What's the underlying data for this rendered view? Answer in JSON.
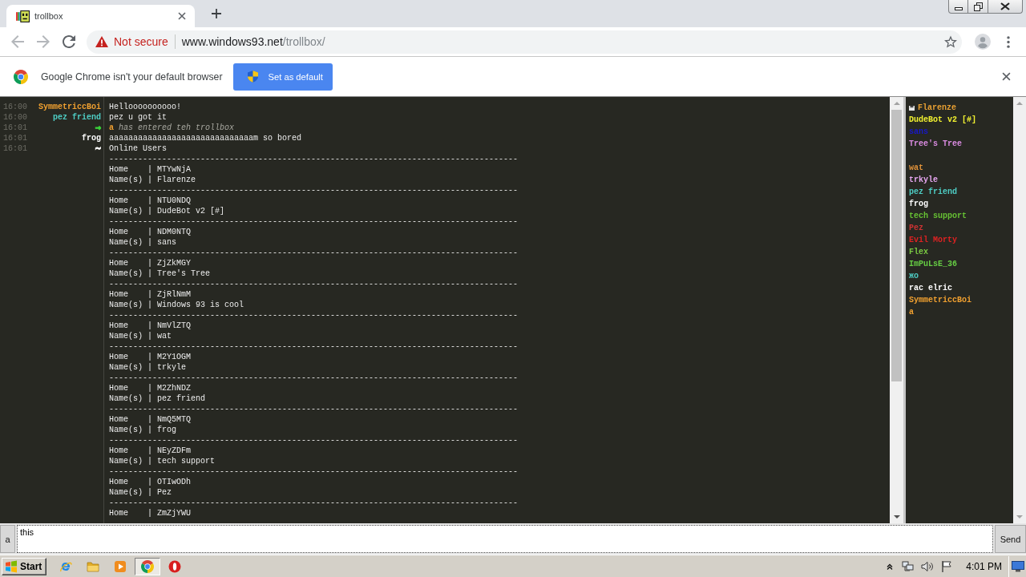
{
  "browser": {
    "tabs": [
      {
        "title": "trollbox",
        "selected": true
      }
    ],
    "address": {
      "security": "Not secure",
      "host": "www.windows93.net",
      "path": "/trollbox/"
    },
    "infobar": {
      "message": "Google Chrome isn't your default browser",
      "button": "Set as default"
    }
  },
  "chat": {
    "messages": [
      {
        "kind": "chat",
        "time": "16:00",
        "nick": "SymmetriccBoi",
        "color": "#f0a030",
        "text": "Helloooooooooo!"
      },
      {
        "kind": "chat",
        "time": "16:00",
        "nick": "pez friend",
        "color": "#4ecdc4",
        "text": "pez u got it"
      },
      {
        "kind": "join",
        "time": "16:01",
        "nick": "→",
        "color": "#3ad23a",
        "user": {
          "name": "a",
          "color": "#f0a030"
        },
        "text": "has entered teh trollbox"
      },
      {
        "kind": "chat",
        "time": "16:01",
        "nick": "frog",
        "color": "#ffffff",
        "text": "aaaaaaaaaaaaaaaaaaaaaaaaaaaaaam so bored"
      },
      {
        "kind": "list",
        "time": "16:01",
        "nick": "~",
        "color": "#ffffff",
        "text": "Online Users",
        "lines": [
          "-------------------------------------------------------------------------------------",
          "Home    | MTYwNjA",
          "Name(s) | Flarenze",
          "-------------------------------------------------------------------------------------",
          "Home    | NTU0NDQ",
          "Name(s) | DudeBot v2 [#]",
          "-------------------------------------------------------------------------------------",
          "Home    | NDM0NTQ",
          "Name(s) | sans",
          "-------------------------------------------------------------------------------------",
          "Home    | ZjZkMGY",
          "Name(s) | Tree's Tree",
          "-------------------------------------------------------------------------------------",
          "Home    | ZjRlNmM",
          "Name(s) | Windows 93 is cool",
          "-------------------------------------------------------------------------------------",
          "Home    | NmVlZTQ",
          "Name(s) | wat",
          "-------------------------------------------------------------------------------------",
          "Home    | M2Y1OGM",
          "Name(s) | trkyle",
          "-------------------------------------------------------------------------------------",
          "Home    | M2ZhNDZ",
          "Name(s) | pez friend",
          "-------------------------------------------------------------------------------------",
          "Home    | NmQ5MTQ",
          "Name(s) | frog",
          "-------------------------------------------------------------------------------------",
          "Home    | NEyZDFm",
          "Name(s) | tech support",
          "-------------------------------------------------------------------------------------",
          "Home    | OTIwODh",
          "Name(s) | Pez",
          "-------------------------------------------------------------------------------------",
          "Home    | ZmZjYWU"
        ]
      }
    ]
  },
  "users": {
    "items": [
      {
        "kind": "name",
        "name": "Flarenze",
        "color": "#e8a033",
        "icon": true
      },
      {
        "kind": "name",
        "name": "DudeBot v2 [#]",
        "color": "#f0f030",
        "icon": false
      },
      {
        "kind": "name",
        "name": "sans",
        "color": "#1818c8",
        "icon": false
      },
      {
        "kind": "name",
        "name": "Tree's Tree",
        "color": "#d98be0",
        "icon": false
      },
      {
        "kind": "gap"
      },
      {
        "kind": "name",
        "name": "wat",
        "color": "#e0923a",
        "icon": false
      },
      {
        "kind": "name",
        "name": "trkyle",
        "color": "#e6a6f0",
        "icon": false
      },
      {
        "kind": "name",
        "name": "pez friend",
        "color": "#4ecdc4",
        "icon": false
      },
      {
        "kind": "name",
        "name": "frog",
        "color": "#ffffff",
        "icon": false
      },
      {
        "kind": "name",
        "name": "tech support",
        "color": "#66c033",
        "icon": false
      },
      {
        "kind": "name",
        "name": "Pez",
        "color": "#cc3333",
        "icon": false
      },
      {
        "kind": "name",
        "name": "Evil Morty",
        "color": "#dd2222",
        "icon": false
      },
      {
        "kind": "name",
        "name": "Flex",
        "color": "#7ac943",
        "icon": false
      },
      {
        "kind": "name",
        "name": "ImPuLsE_36",
        "color": "#66cc44",
        "icon": false
      },
      {
        "kind": "name",
        "name": "жo",
        "color": "#4ecdc4",
        "icon": false
      },
      {
        "kind": "name",
        "name": "rac elric",
        "color": "#ffffff",
        "icon": false
      },
      {
        "kind": "name",
        "name": "SymmetriccBoi",
        "color": "#f0a030",
        "icon": false
      },
      {
        "kind": "name",
        "name": "a",
        "color": "#f0a030",
        "icon": false
      }
    ]
  },
  "composer": {
    "nick": "a",
    "value": "this",
    "send": "Send"
  },
  "taskbar": {
    "start": "Start",
    "apps": [
      {
        "kind": "ie",
        "selected": false
      },
      {
        "kind": "explorer",
        "selected": false
      },
      {
        "kind": "mediaplayer",
        "selected": false
      },
      {
        "kind": "chrome",
        "selected": true
      },
      {
        "kind": "app",
        "selected": false
      }
    ],
    "clock": "4:01 PM"
  }
}
